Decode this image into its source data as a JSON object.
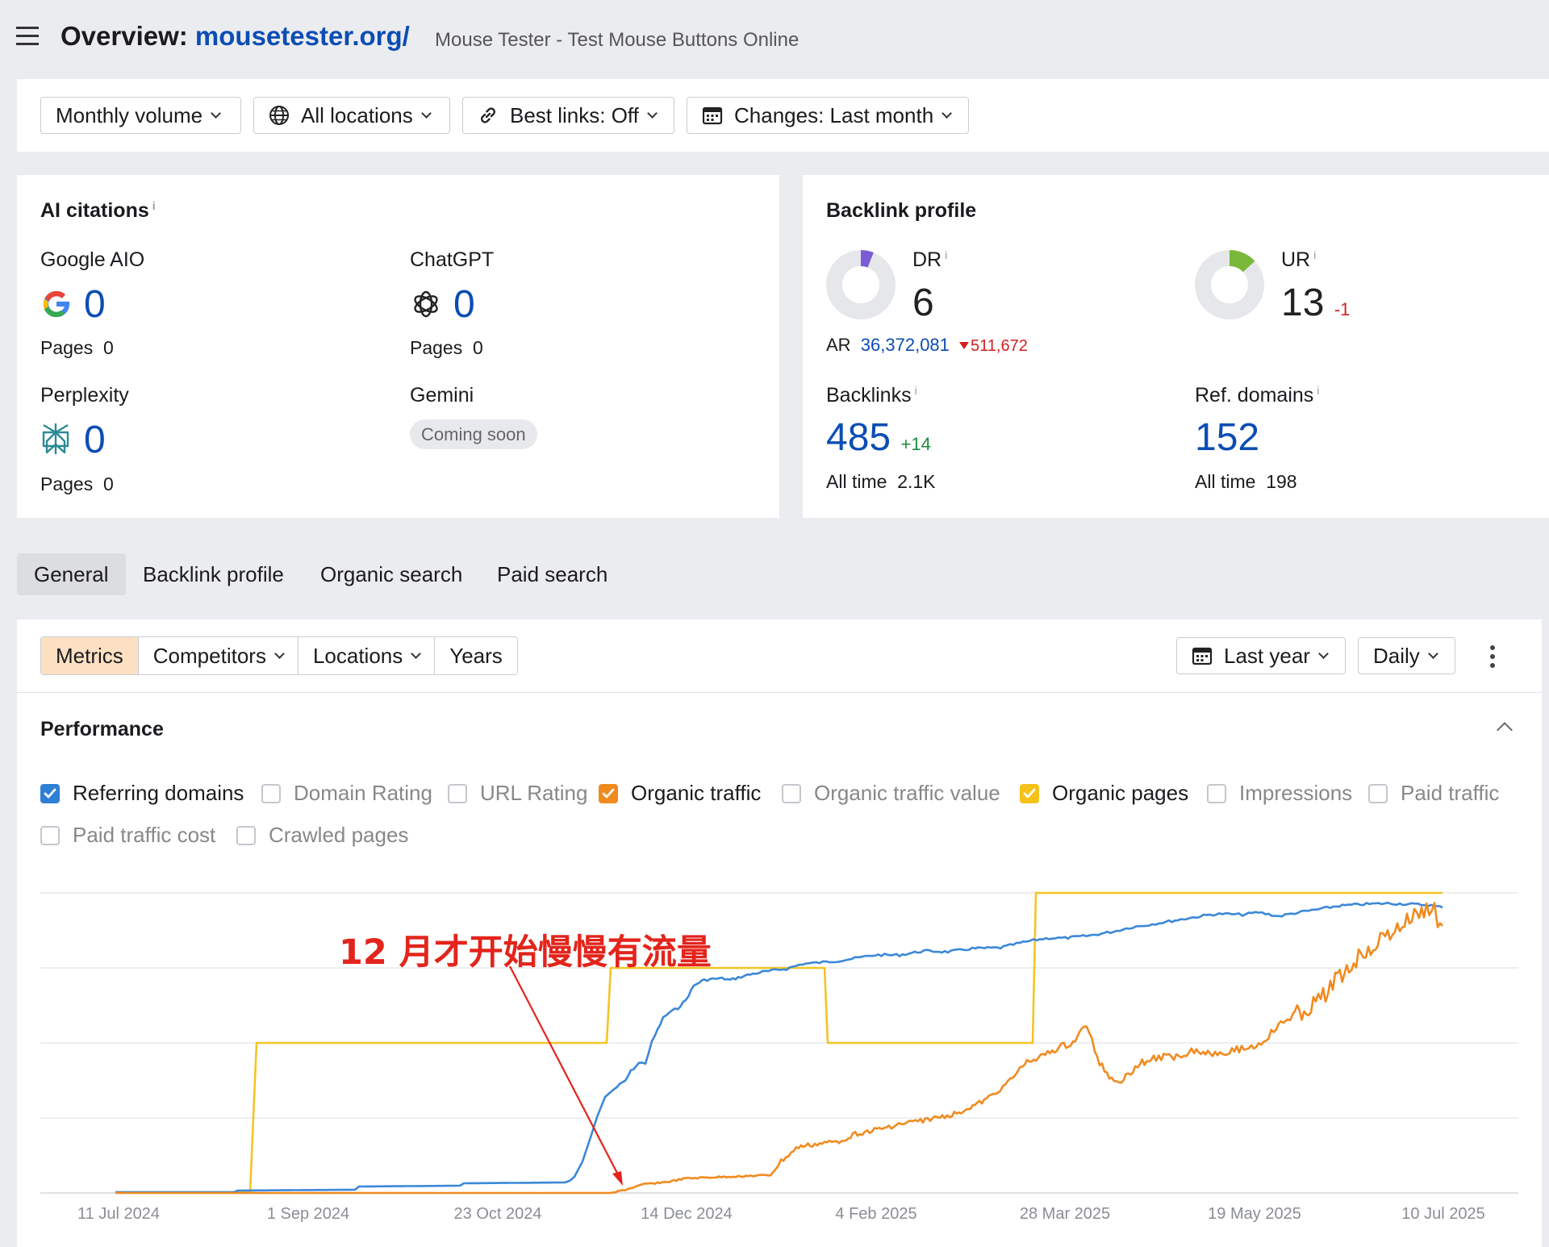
{
  "header": {
    "title_prefix": "Overview:",
    "domain": "mousetester.org/",
    "subtitle": "Mouse Tester - Test Mouse Buttons Online"
  },
  "filters": {
    "volume": "Monthly volume",
    "locations": "All locations",
    "best_links": "Best links: Off",
    "changes": "Changes: Last month"
  },
  "ai_citations": {
    "title": "AI citations",
    "info": "i",
    "google": {
      "label": "Google AIO",
      "value": "0",
      "pages_label": "Pages",
      "pages": "0"
    },
    "chatgpt": {
      "label": "ChatGPT",
      "value": "0",
      "pages_label": "Pages",
      "pages": "0"
    },
    "perplexity": {
      "label": "Perplexity",
      "value": "0",
      "pages_label": "Pages",
      "pages": "0"
    },
    "gemini": {
      "label": "Gemini",
      "badge": "Coming soon"
    }
  },
  "backlink_profile": {
    "title": "Backlink profile",
    "dr": {
      "label": "DR",
      "info": "i",
      "value": "6",
      "ring_fraction": 0.06,
      "ring_color": "#7b5cd6"
    },
    "ur": {
      "label": "UR",
      "info": "i",
      "value": "13",
      "change": "-1",
      "ring_fraction": 0.13,
      "ring_color": "#7ab83a"
    },
    "ar": {
      "label": "AR",
      "value": "36,372,081",
      "change": "511,672"
    },
    "backlinks": {
      "label": "Backlinks",
      "info": "i",
      "value": "485",
      "change": "+14",
      "alltime_label": "All time",
      "alltime": "2.1K"
    },
    "ref_domains": {
      "label": "Ref. domains",
      "info": "i",
      "value": "152",
      "alltime_label": "All time",
      "alltime": "198"
    }
  },
  "tabs": [
    "General",
    "Backlink profile",
    "Organic search",
    "Paid search"
  ],
  "toolbar": {
    "metrics": "Metrics",
    "competitors": "Competitors",
    "locations": "Locations",
    "years": "Years",
    "range": "Last year",
    "interval": "Daily"
  },
  "performance": {
    "title": "Performance",
    "checkboxes": [
      {
        "label": "Referring domains",
        "checked": true,
        "color": "#2f7fd6"
      },
      {
        "label": "Domain Rating",
        "checked": false
      },
      {
        "label": "URL Rating",
        "checked": false
      },
      {
        "label": "Organic traffic",
        "checked": true,
        "color": "#f08a1c"
      },
      {
        "label": "Organic traffic value",
        "checked": false
      },
      {
        "label": "Organic pages",
        "checked": true,
        "color": "#f5c21b"
      },
      {
        "label": "Impressions",
        "checked": false
      },
      {
        "label": "Paid traffic",
        "checked": false
      },
      {
        "label": "Paid traffic cost",
        "checked": false
      },
      {
        "label": "Crawled pages",
        "checked": false
      }
    ]
  },
  "chart_data": {
    "type": "line",
    "x_ticks": [
      "11 Jul 2024",
      "1 Sep 2024",
      "23 Oct 2024",
      "14 Dec 2024",
      "4 Feb 2025",
      "28 Mar 2025",
      "19 May 2025",
      "10 Jul 2025"
    ],
    "grid": true,
    "annotation": "12 月才开始慢慢有流量",
    "series": [
      {
        "name": "Referring domains",
        "color": "#3b88d8"
      },
      {
        "name": "Organic traffic",
        "color": "#f18a1e"
      },
      {
        "name": "Organic pages",
        "color": "#f5c425"
      }
    ]
  }
}
